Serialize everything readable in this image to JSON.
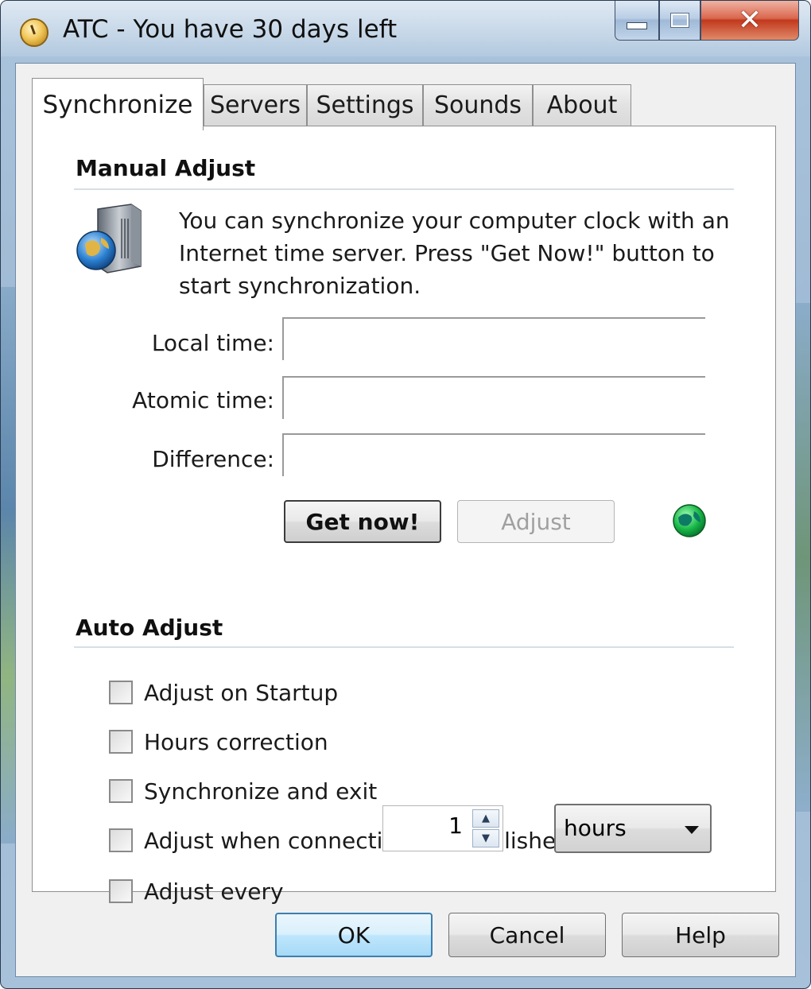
{
  "window": {
    "title": "ATC - You have 30 days left",
    "icon": "clock-icon",
    "caption_buttons": {
      "minimize": "minimize-icon",
      "maximize": "maximize-icon",
      "close": "✕"
    }
  },
  "tabs": [
    {
      "label": "Synchronize",
      "active": true
    },
    {
      "label": "Servers",
      "active": false
    },
    {
      "label": "Settings",
      "active": false
    },
    {
      "label": "Sounds",
      "active": false
    },
    {
      "label": "About",
      "active": false
    }
  ],
  "manual": {
    "title": "Manual Adjust",
    "icon": "server-globe-icon",
    "description": "You can synchronize your computer clock with an Internet time server. Press \"Get Now!\" button to start synchronization.",
    "local_time_label": "Local time:",
    "local_time_value": "",
    "atomic_time_label": "Atomic time:",
    "atomic_time_value": "",
    "difference_label": "Difference:",
    "difference_value": "",
    "get_now_label": "Get now!",
    "adjust_label": "Adjust",
    "status_icon": "green-globe-icon",
    "status_color": "#1db954"
  },
  "auto": {
    "title": "Auto Adjust",
    "options": [
      {
        "label": "Adjust on Startup",
        "checked": false
      },
      {
        "label": "Hours correction",
        "checked": false
      },
      {
        "label": "Synchronize and exit",
        "checked": false
      },
      {
        "label": "Adjust when connection is established",
        "checked": false
      },
      {
        "label": "Adjust every",
        "checked": false
      }
    ],
    "interval_value": "1",
    "interval_unit": "hours"
  },
  "footer": {
    "ok_label": "OK",
    "cancel_label": "Cancel",
    "help_label": "Help"
  },
  "colors": {
    "default_button_border": "#3c7fb1",
    "close_button": "#c2391d"
  }
}
